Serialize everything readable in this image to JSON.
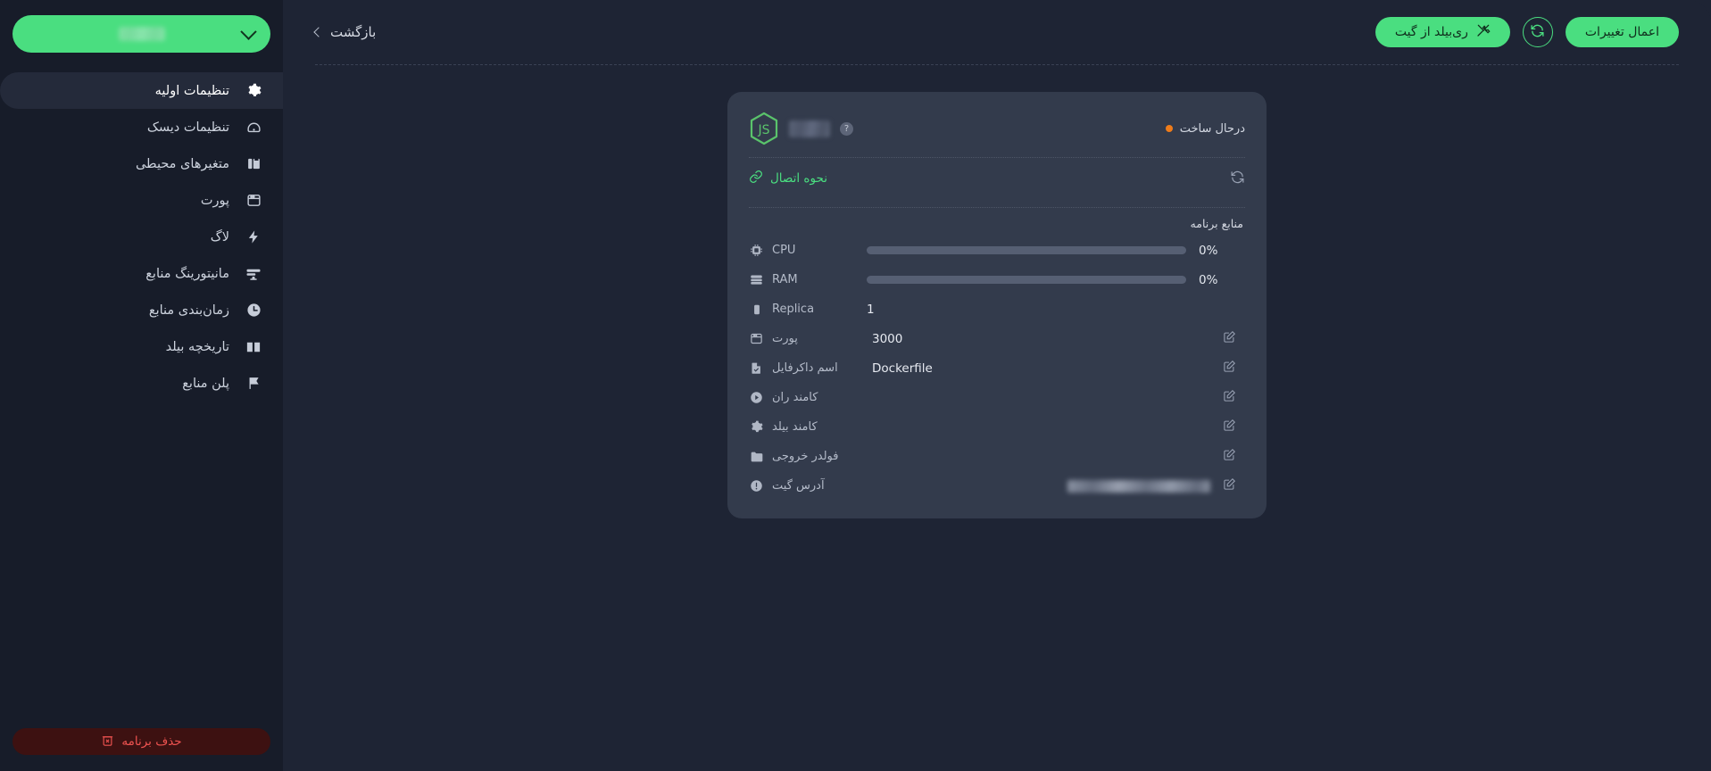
{
  "colors": {
    "accent_green": "#4ade80",
    "background": "#1e2434",
    "sidebar_bg": "#171c29",
    "card_bg": "#333b4c",
    "status_orange": "#ef7c1a",
    "danger_red": "#ef5350"
  },
  "sidebar": {
    "project_selector": {
      "name": "",
      "icon": "chevron-down-icon"
    },
    "items": [
      {
        "label": "تنظیمات اولیه",
        "icon": "gear-icon",
        "active": true
      },
      {
        "label": "تنظیمات دیسک",
        "icon": "disk-icon",
        "active": false
      },
      {
        "label": "متغیرهای محیطی",
        "icon": "variables-icon",
        "active": false
      },
      {
        "label": "پورت",
        "icon": "port-icon",
        "active": false
      },
      {
        "label": "لاگ",
        "icon": "bolt-icon",
        "active": false
      },
      {
        "label": "مانیتورینگ منابع",
        "icon": "monitor-icon",
        "active": false
      },
      {
        "label": "زمان‌بندی منابع",
        "icon": "clock-icon",
        "active": false
      },
      {
        "label": "تاریخچه بیلد",
        "icon": "book-icon",
        "active": false
      },
      {
        "label": "پلن منابع",
        "icon": "flag-icon",
        "active": false
      }
    ],
    "delete_button": {
      "label": "حذف برنامه",
      "icon": "trash-x-icon"
    }
  },
  "topbar": {
    "back_label": "بازگشت",
    "back_icon": "chevron-left-icon",
    "apply_changes_label": "اعمال تغییرات",
    "refresh_icon": "refresh-icon",
    "rebuild_label": "ری‌بیلد از گیت",
    "rebuild_icon": "tools-icon"
  },
  "card": {
    "runtime_logo": "nodejs-js-icon",
    "app_name": "",
    "help_icon": "question-mark-icon",
    "status_label": "درحال ساخت",
    "status_icon": "status-dot-orange",
    "connection_label": "نحوه اتصال",
    "connection_icon": "link-icon",
    "card_refresh_icon": "refresh-icon",
    "resources_title": "منابع برنامه",
    "resource_rows": [
      {
        "label": "CPU",
        "icon": "cpu-icon",
        "value": "0%",
        "percent": 0,
        "type": "bar"
      },
      {
        "label": "RAM",
        "icon": "ram-icon",
        "value": "0%",
        "percent": 0,
        "type": "bar"
      },
      {
        "label": "Replica",
        "icon": "replica-icon",
        "value": "1",
        "type": "text"
      }
    ],
    "setting_rows": [
      {
        "label": "پورت",
        "icon": "window-icon",
        "value": "3000",
        "edit_icon": "edit-pencil-icon"
      },
      {
        "label": "اسم داکرفایل",
        "icon": "file-check-icon",
        "value": "Dockerfile",
        "edit_icon": "edit-pencil-icon"
      },
      {
        "label": "کامند ران",
        "icon": "play-circle-icon",
        "value": "",
        "edit_icon": "edit-pencil-icon"
      },
      {
        "label": "کامند بیلد",
        "icon": "gear-icon",
        "value": "",
        "edit_icon": "edit-pencil-icon"
      },
      {
        "label": "فولدر خروجی",
        "icon": "folder-icon",
        "value": "",
        "edit_icon": "edit-pencil-icon"
      },
      {
        "label": "آدرس گیت",
        "icon": "info-icon",
        "value": "",
        "redacted": true,
        "edit_icon": "edit-pencil-icon"
      }
    ]
  }
}
